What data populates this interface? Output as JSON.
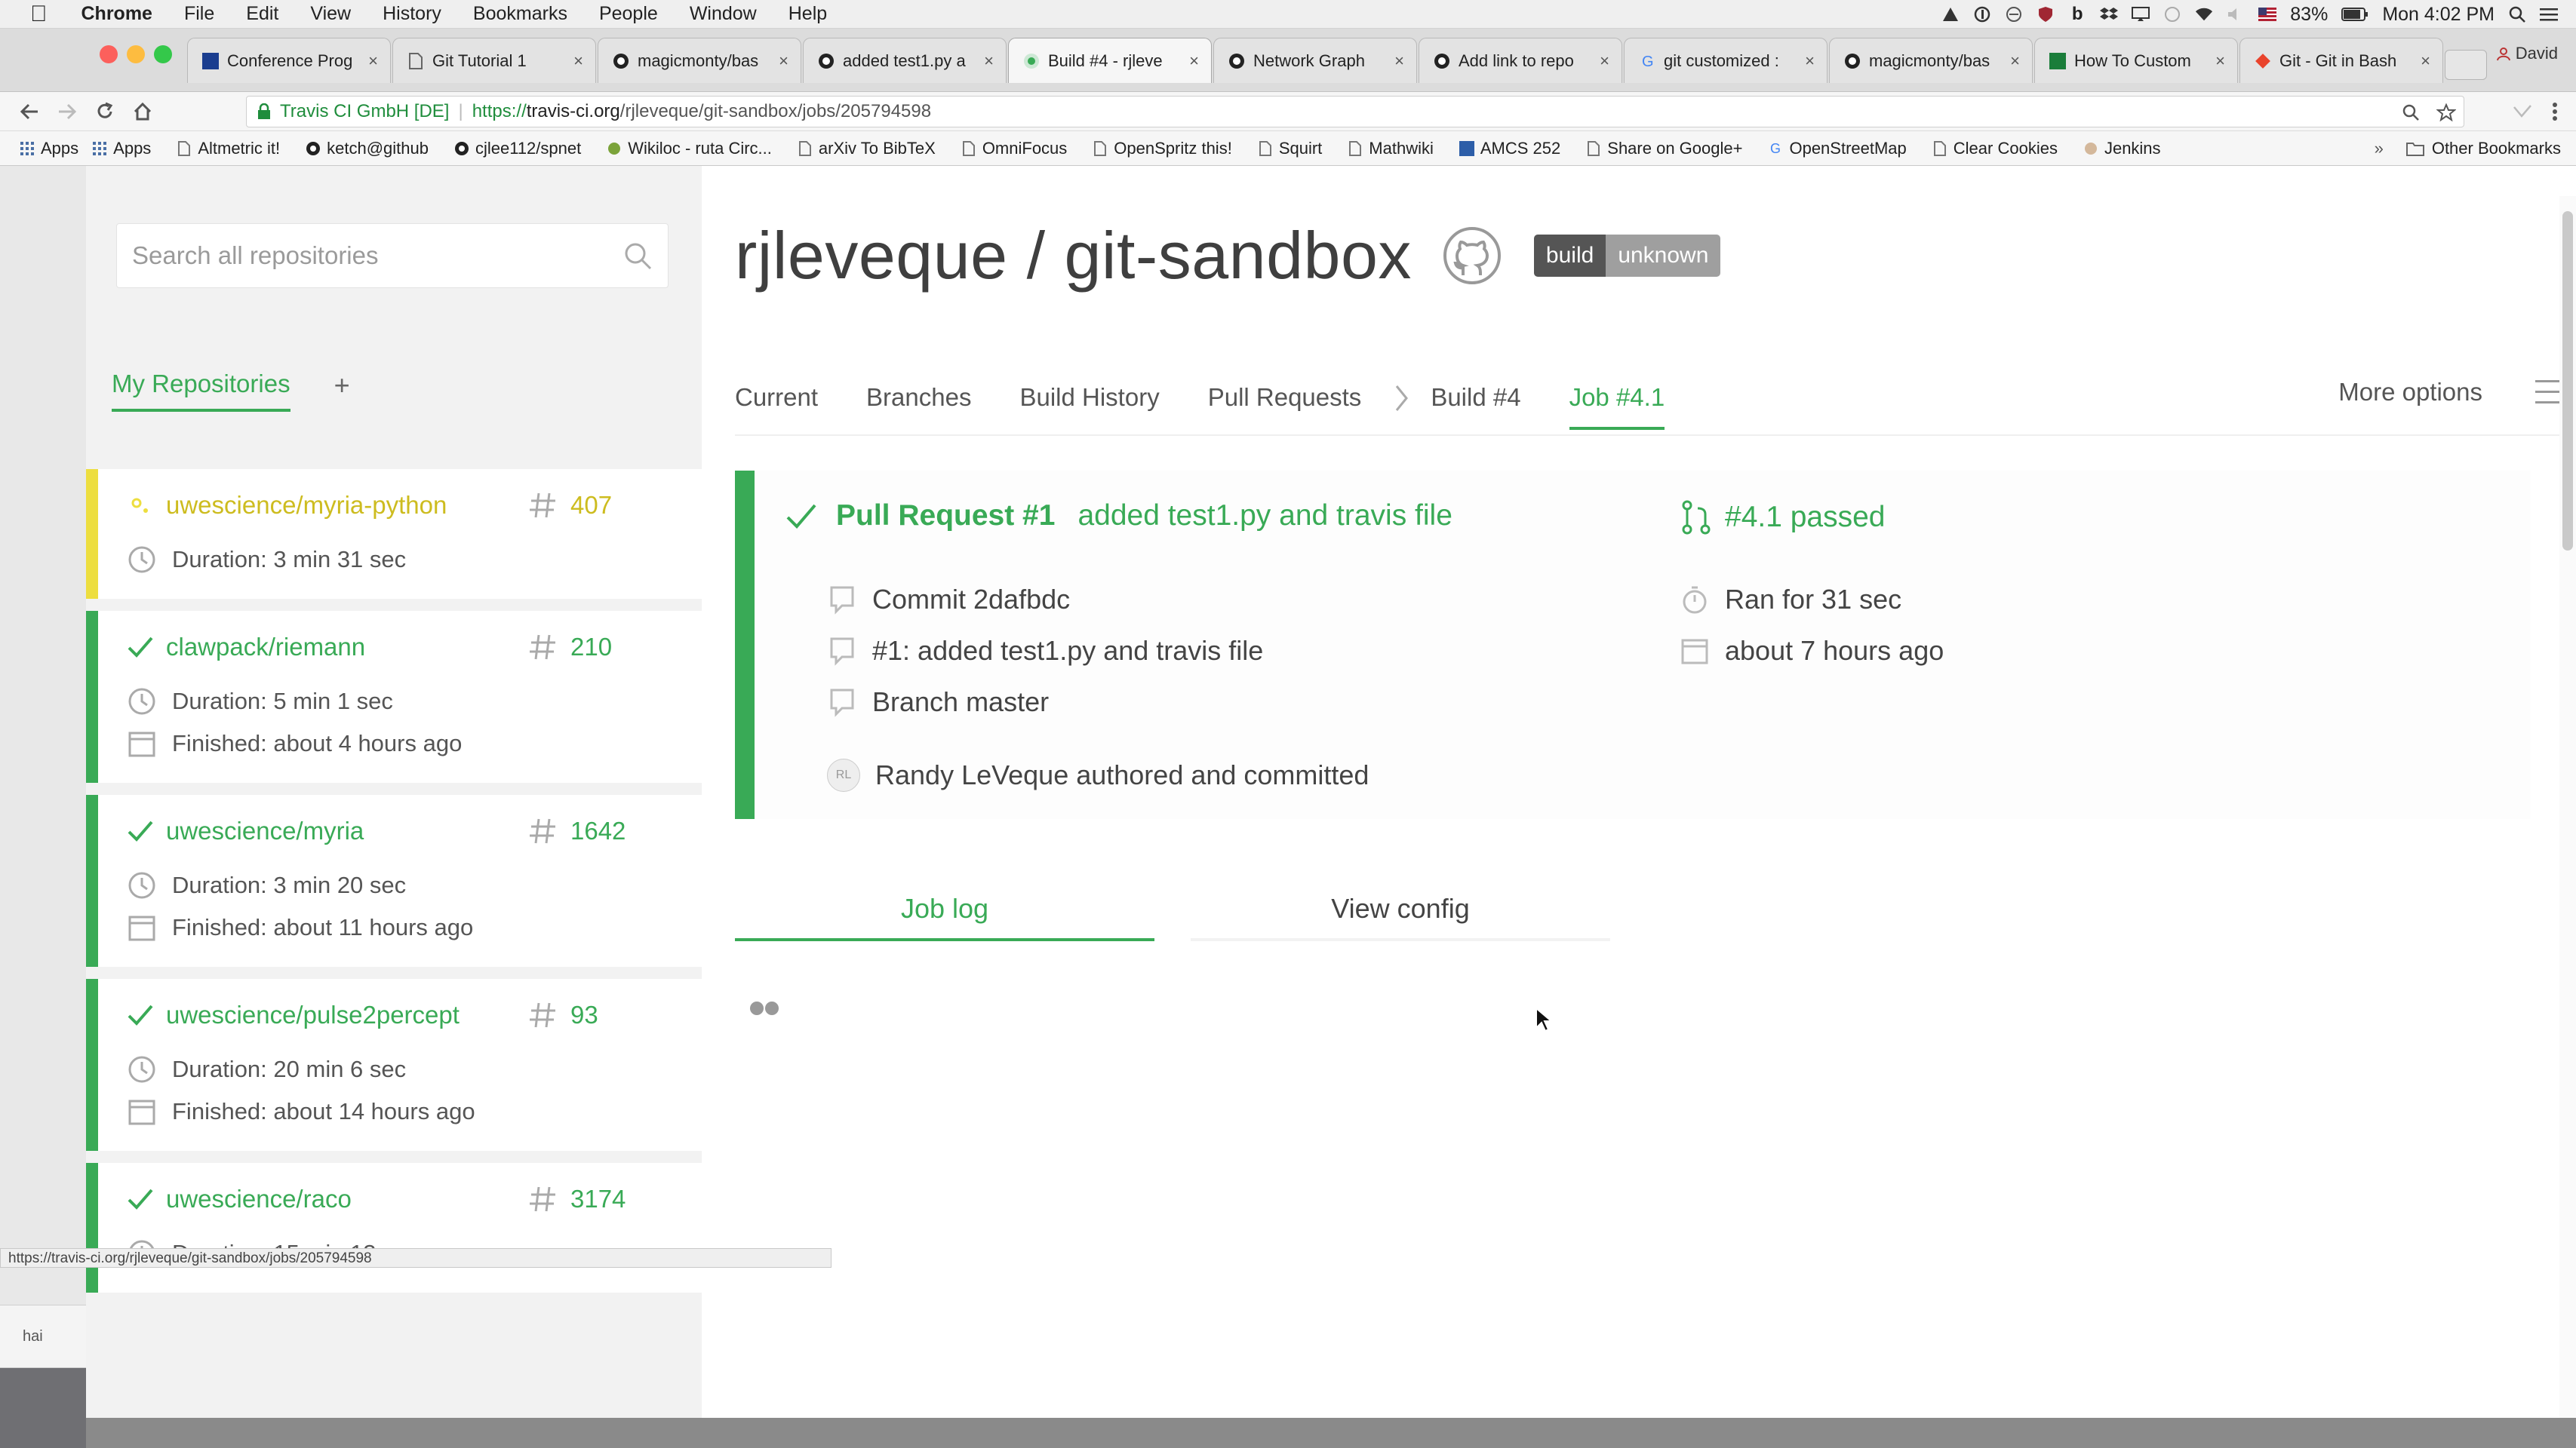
{
  "menubar": {
    "app_name": "Chrome",
    "items": [
      "File",
      "Edit",
      "View",
      "History",
      "Bookmarks",
      "People",
      "Window",
      "Help"
    ],
    "battery": "83%",
    "clock": "Mon 4:02 PM"
  },
  "browser": {
    "profile_name": "David",
    "tabs": [
      {
        "title": "Conference Prog",
        "icon": "conference-icon"
      },
      {
        "title": "Git Tutorial 1",
        "icon": "doc-icon"
      },
      {
        "title": "magicmonty/bas",
        "icon": "github-icon"
      },
      {
        "title": "added test1.py a",
        "icon": "github-icon"
      },
      {
        "title": "Build #4 - rjleve",
        "icon": "travis-icon"
      },
      {
        "title": "Network Graph",
        "icon": "github-icon"
      },
      {
        "title": "Add link to repo",
        "icon": "github-icon"
      },
      {
        "title": "git customized :",
        "icon": "google-icon"
      },
      {
        "title": "magicmonty/bas",
        "icon": "github-icon"
      },
      {
        "title": "How To Custom",
        "icon": "howto-icon"
      },
      {
        "title": "Git - Git in Bash",
        "icon": "git-icon"
      }
    ],
    "active_tab_index": 4,
    "address": {
      "org": "Travis CI GmbH [DE]",
      "scheme": "https://",
      "host": "travis-ci.org",
      "path": "/rjleveque/git-sandbox/jobs/205794598"
    },
    "bookmarks": [
      {
        "label": "Apps",
        "icon": "apps-grid-icon"
      },
      {
        "label": "Altmetric it!",
        "icon": "bookmark-page-icon"
      },
      {
        "label": "ketch@github",
        "icon": "github-icon"
      },
      {
        "label": "cjlee112/spnet",
        "icon": "github-icon"
      },
      {
        "label": "Wikiloc - ruta Circ...",
        "icon": "wikiloc-icon"
      },
      {
        "label": "arXiv To BibTeX",
        "icon": "bookmark-page-icon"
      },
      {
        "label": "OmniFocus",
        "icon": "bookmark-page-icon"
      },
      {
        "label": "OpenSpritz this!",
        "icon": "bookmark-page-icon"
      },
      {
        "label": "Squirt",
        "icon": "bookmark-page-icon"
      },
      {
        "label": "Mathwiki",
        "icon": "bookmark-page-icon"
      },
      {
        "label": "AMCS 252",
        "icon": "amcs-icon"
      },
      {
        "label": "Share on Google+",
        "icon": "bookmark-page-icon"
      },
      {
        "label": "OpenStreetMap",
        "icon": "google-icon"
      },
      {
        "label": "Clear Cookies",
        "icon": "bookmark-page-icon"
      },
      {
        "label": "Jenkins",
        "icon": "jenkins-icon"
      }
    ],
    "bookmarks_other": "Other Bookmarks",
    "apps_short": "Apps",
    "status_url": "https://travis-ci.org/rjleveque/git-sandbox/jobs/205794598",
    "background_window_label": "hai"
  },
  "sidebar": {
    "search_placeholder": "Search all repositories",
    "tab_label": "My Repositories",
    "add_label": "+",
    "repos": [
      {
        "name": "uwescience/myria-python",
        "number": "407",
        "status": "running",
        "duration": "Duration: 3 min 31 sec",
        "finished": ""
      },
      {
        "name": "clawpack/riemann",
        "number": "210",
        "status": "passed",
        "duration": "Duration: 5 min 1 sec",
        "finished": "Finished: about 4 hours ago"
      },
      {
        "name": "uwescience/myria",
        "number": "1642",
        "status": "passed",
        "duration": "Duration: 3 min 20 sec",
        "finished": "Finished: about 11 hours ago"
      },
      {
        "name": "uwescience/pulse2percept",
        "number": "93",
        "status": "passed",
        "duration": "Duration: 20 min 6 sec",
        "finished": "Finished: about 14 hours ago"
      },
      {
        "name": "uwescience/raco",
        "number": "3174",
        "status": "passed",
        "duration": "Duration: 15 min 13 sec",
        "finished": ""
      }
    ]
  },
  "main": {
    "repo_title": "rjleveque / git-sandbox",
    "badge": {
      "left": "build",
      "right": "unknown"
    },
    "tabs": [
      {
        "label": "Current",
        "active": false
      },
      {
        "label": "Branches",
        "active": false
      },
      {
        "label": "Build History",
        "active": false
      },
      {
        "label": "Pull Requests",
        "active": false
      },
      {
        "label": "Build #4",
        "active": false
      },
      {
        "label": "Job #4.1",
        "active": true
      }
    ],
    "more_options": "More options",
    "job": {
      "pr_label": "Pull Request #1",
      "pr_title": "added test1.py and travis file",
      "commit": "Commit 2dafbdc",
      "compare": "#1: added test1.py and travis file",
      "branch": "Branch master",
      "author": "Randy LeVeque authored and committed",
      "status": "#4.1 passed",
      "ran_for": "Ran for 31 sec",
      "when": "about 7 hours ago"
    },
    "log_tabs": {
      "active": "Job log",
      "inactive": "View config"
    }
  },
  "colors": {
    "accent_green": "#39aa56",
    "pending_yellow": "#edde3f",
    "badge_dark": "#555555",
    "badge_gray": "#9f9f9f"
  }
}
